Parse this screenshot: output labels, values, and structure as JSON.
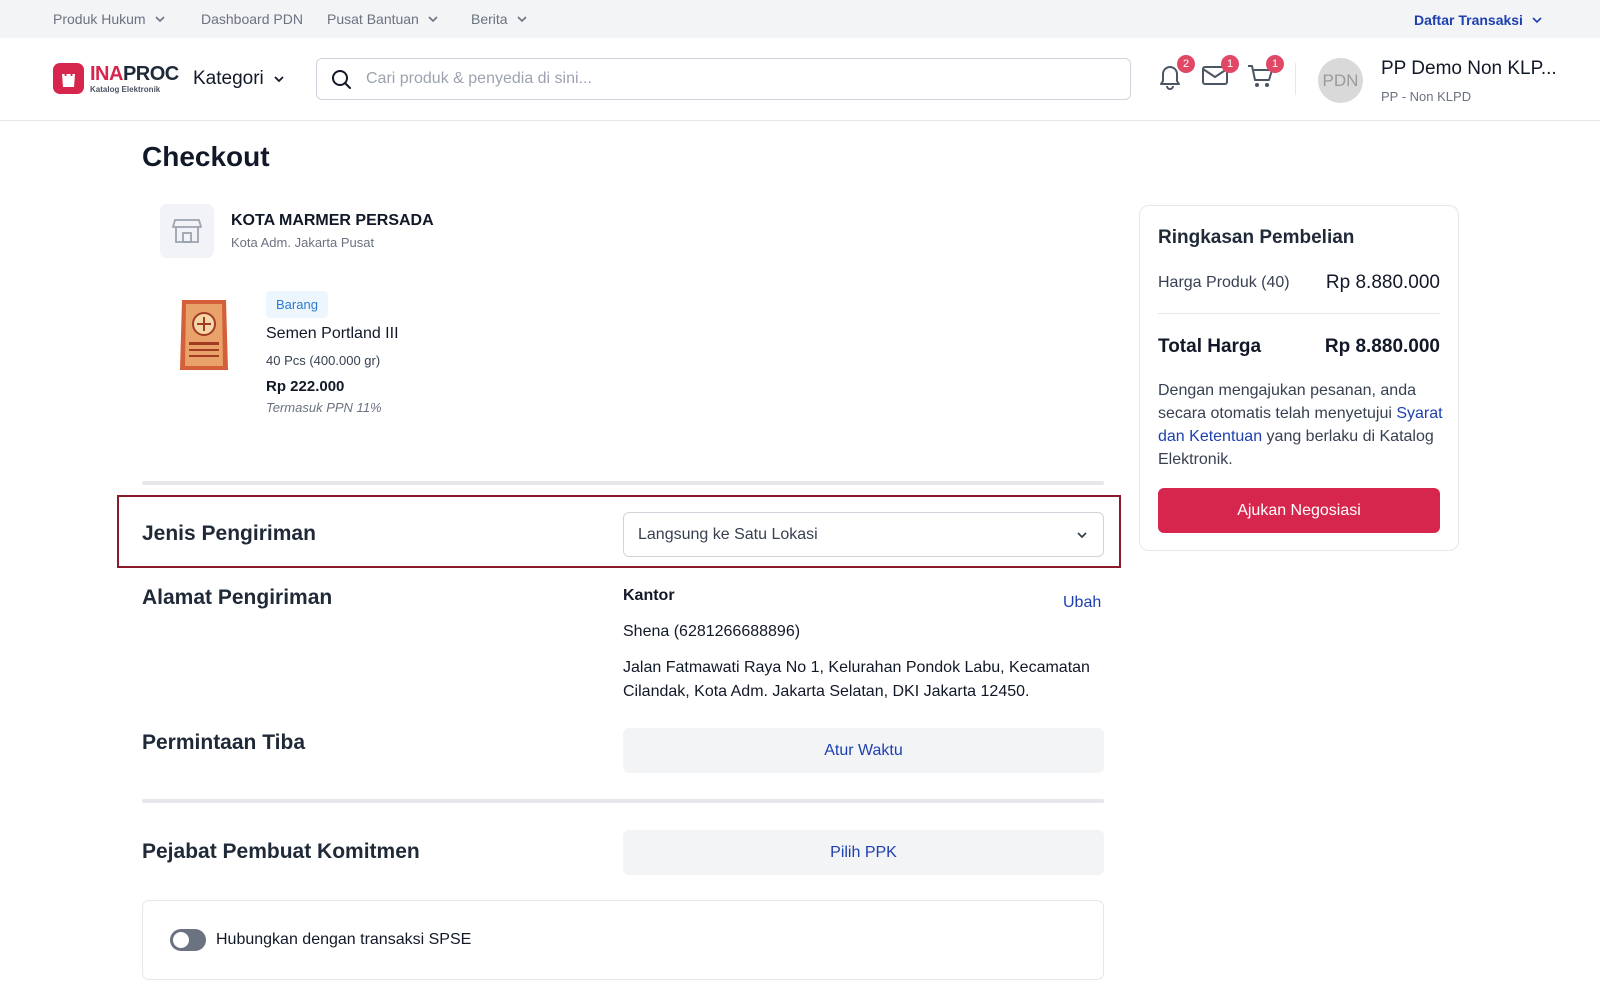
{
  "topbar": {
    "items": [
      {
        "label": "Produk Hukum"
      },
      {
        "label": "Dashboard PDN"
      },
      {
        "label": "Pusat Bantuan"
      },
      {
        "label": "Berita"
      }
    ],
    "transactions_label": "Daftar Transaksi"
  },
  "header": {
    "logo_main_a": "INA",
    "logo_main_b": "PROC",
    "logo_sub": "Katalog Elektronik",
    "kategori_label": "Kategori",
    "search_placeholder": "Cari produk & penyedia di sini...",
    "notification_count": "2",
    "message_count": "1",
    "cart_count": "1",
    "avatar_initials": "PDN",
    "user_name": "PP Demo Non KLP...",
    "user_role": "PP - Non KLPD"
  },
  "page": {
    "title": "Checkout"
  },
  "store": {
    "name": "KOTA MARMER PERSADA",
    "location": "Kota Adm. Jakarta Pusat"
  },
  "product": {
    "type_chip": "Barang",
    "name": "Semen Portland III",
    "quantity": "40 Pcs (400.000 gr)",
    "price": "Rp 222.000",
    "tax_note": "Termasuk PPN 11%"
  },
  "shipping": {
    "type_label": "Jenis Pengiriman",
    "type_value": "Langsung ke Satu Lokasi",
    "address_label": "Alamat Pengiriman",
    "address_type": "Kantor",
    "change_label": "Ubah",
    "recipient": "Shena (6281266688896)",
    "address": "Jalan Fatmawati Raya No 1, Kelurahan Pondok Labu, Kecamatan Cilandak, Kota Adm. Jakarta Selatan, DKI Jakarta 12450.",
    "arrival_label": "Permintaan Tiba",
    "arrival_button": "Atur Waktu"
  },
  "commitment": {
    "label": "Pejabat Pembuat Komitmen",
    "button": "Pilih PPK",
    "spse_label": "Hubungkan dengan transaksi SPSE"
  },
  "summary": {
    "title": "Ringkasan Pembelian",
    "product_price_label": "Harga Produk (40)",
    "product_price_value": "Rp 8.880.000",
    "total_label": "Total Harga",
    "total_value": "Rp 8.880.000",
    "note_before": "Dengan mengajukan pesanan, anda secara otomatis telah menyetujui ",
    "note_link": "Syarat dan Ketentuan",
    "note_after": " yang berlaku di Katalog Elektronik.",
    "submit_button": "Ajukan Negosiasi"
  },
  "colors": {
    "brand": "#d7264e",
    "link": "#1e40af",
    "highlight_border": "#8b1a2a"
  }
}
